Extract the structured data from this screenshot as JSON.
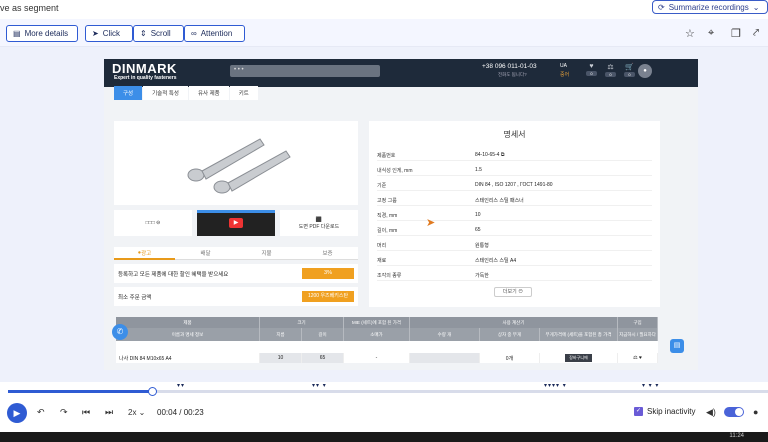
{
  "header": {
    "segment_title": "ve as segment",
    "summarize_label": "Summarize recordings"
  },
  "toolbar": {
    "more_details": "More details",
    "click": "Click",
    "scroll": "Scroll",
    "attention": "Attention"
  },
  "site": {
    "logo": "DINMARK",
    "logo_sub": "Expert in quality fasteners",
    "search_placeholder": "• • •",
    "phone": "+38 096 011-01-03",
    "phone_sub": "전화도 됩니다?",
    "lang": "UA",
    "lang_alt": "중어",
    "header_badges": [
      "0",
      "0",
      "0"
    ],
    "tabs": [
      "구성",
      "기술적 특성",
      "유사 제품",
      "키트"
    ],
    "thumb_left": "□□□ ⊖",
    "thumb_right": "도면 PDF 다운로드",
    "info_tabs": [
      "광고",
      "배달",
      "지불",
      "보증"
    ],
    "promo_text": "등록하고 모든 제품에 대한 할인 혜택을 받으세요",
    "promo_badge": "3%",
    "min_order_label": "최소 주문 금액",
    "min_order_value": "1200 우즈베키스탄",
    "spec_title": "명세서",
    "spec_rows": [
      {
        "k": "제품번호",
        "v": "84-10-65-4 ⧉"
      },
      {
        "k": "내식성 인게, mm",
        "v": "1.5"
      },
      {
        "k": "기준",
        "v": "DIN 84 , ISO 1207 , ГОСТ 1491-80"
      },
      {
        "k": "고정 그룹",
        "v": "스테인리스 스틸 패스너"
      },
      {
        "k": "직경, mm",
        "v": "10"
      },
      {
        "k": "길이, mm",
        "v": "65"
      },
      {
        "k": "머리",
        "v": "원통형"
      },
      {
        "k": "재료",
        "v": "스테인리스 스틸 A4"
      },
      {
        "k": "조각의 종류",
        "v": "가득한"
      }
    ],
    "more_label": "더보기 ⊖",
    "table_headers": [
      "제품",
      "크기",
      "MIE (세트)에 포함 된 가격",
      "사용 계산기",
      "구입"
    ],
    "table_subheaders": [
      "이름과 명세 정보",
      "지름",
      "길이",
      "소매가",
      "수량 개",
      "상자 중 무게",
      "무게가격에 (세트)을 포함된 총 가격",
      "지금하시 / 필요하다"
    ],
    "row": {
      "name": "나사 DIN 84 M10x65 A4",
      "diameter": "10",
      "length": "65",
      "price": "-",
      "qty": "",
      "weight": "0개",
      "total": "",
      "buy": "장바구니에"
    }
  },
  "player": {
    "time": "00:04 / 00:23",
    "speed": "2x",
    "skip_label": "Skip inactivity",
    "progress": 0.19
  },
  "taskbar": {
    "clock": "11:24"
  }
}
